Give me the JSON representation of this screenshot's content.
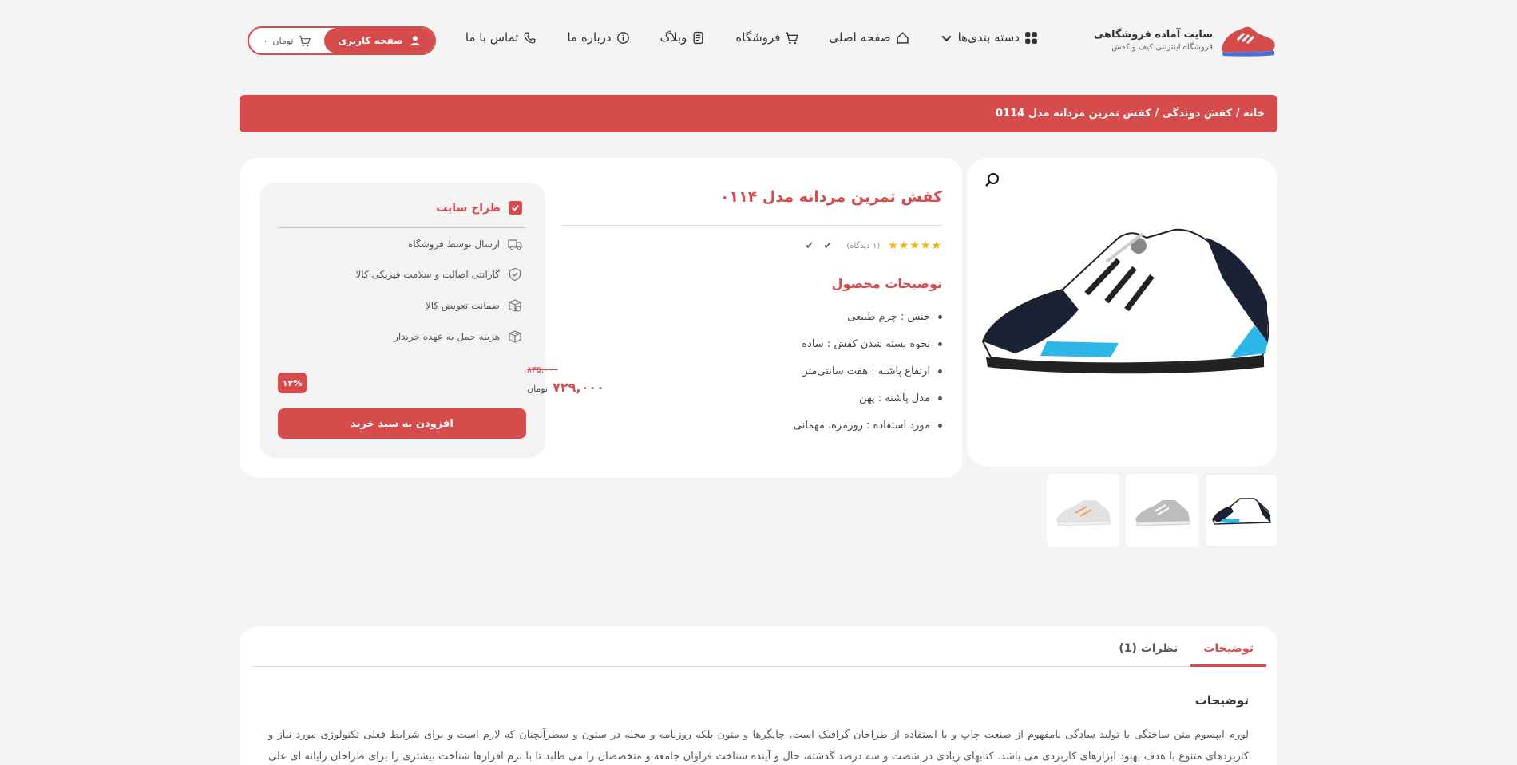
{
  "header": {
    "brand_title": "سایت آماده فروشگاهی",
    "brand_sub": "فروشگاه اینترنتی کیف و کفش",
    "nav": [
      {
        "label": "دسته بندی‌ها",
        "icon": "grid-icon"
      },
      {
        "label": "صفحه اصلی",
        "icon": "home-icon"
      },
      {
        "label": "فروشگاه",
        "icon": "cart-icon"
      },
      {
        "label": "وبلاگ",
        "icon": "document-icon"
      },
      {
        "label": "درباره ما",
        "icon": "info-icon"
      },
      {
        "label": "تماس با ما",
        "icon": "phone-icon"
      }
    ],
    "user_label": "صفحه کاربری",
    "cart_amount": "۰",
    "cart_currency": "تومان"
  },
  "breadcrumb": "خانه / کفش دوندگی / کفش تمرین مردانه مدل 0114",
  "product": {
    "title": "کفش تمرین مردانه مدل ۰۱۱۴",
    "stars": "★★★★★",
    "reviews": "(۱ دیدگاه)",
    "description_heading": "توضیحات محصول",
    "specs": [
      "جنس : چرم طبیعی",
      "نحوه بسته شدن کفش : ساده",
      "ارتفاع پاشنه : هفت سانتی‌متر",
      "مدل پاشنه : پهن",
      "مورد استفاده : روزمره، مهمانی"
    ]
  },
  "purchase_box": {
    "seller": "طراح سایت",
    "features": [
      "ارسال توسط فروشگاه",
      "گارانتی اصالت و سلامت فیزیکی کالا",
      "ضمانت تعویض کالا",
      "هزینه حمل به عهده خریدار"
    ],
    "discount": "۱۳%",
    "old_price": "۸۳۵,۰۰۰",
    "new_price": "۷۲۹,۰۰۰",
    "currency": "تومان",
    "add_to_cart": "افزودن به سبد خرید"
  },
  "tabs": {
    "items": [
      "توضیحات",
      "نظرات (1)"
    ],
    "heading": "توضیحات",
    "body": "لورم ایپسوم متن ساختگی با تولید سادگی نامفهوم از صنعت چاپ و با استفاده از طراحان گرافیک است. چاپگرها و متون بلکه روزنامه و مجله در ستون و سطرآنچنان که لازم است و برای شرایط فعلی تکنولوژی مورد نیاز و کاربردهای متنوع با هدف بهبود ابزارهای کاربردی می باشد. کتابهای زیادی در شصت و سه درصد گذشته، حال و آینده شناخت فراوان جامعه و متخصصان را می طلبد تا با نرم افزارها شناخت بیشتری را برای طراحان رایانه ای علی الخصوص"
  },
  "colors": {
    "accent": "#d64b4b",
    "background": "#f4f4f4",
    "star": "#f5b400"
  }
}
